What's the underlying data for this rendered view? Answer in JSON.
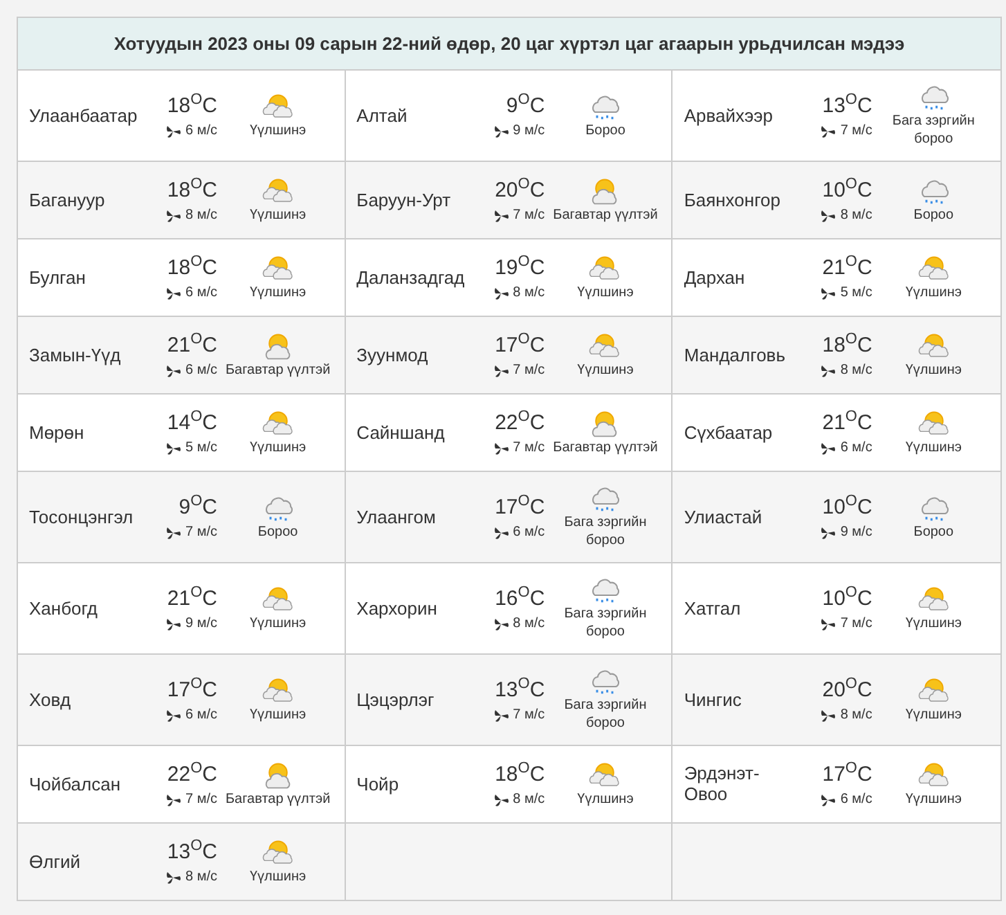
{
  "title": "Хотуудын 2023 оны 09 сарын 22-ний өдөр, 20 цаг хүртэл цаг агаарын урьдчилсан мэдээ",
  "rows": [
    [
      {
        "city": "Улаанбаатар",
        "temp": "18$^{O}$C",
        "wind": "6 м/с",
        "kind": "partly_cloudy",
        "condition": "Үүлшинэ"
      },
      {
        "city": "Алтай",
        "temp": "9$^{O}$C",
        "wind": "9 м/с",
        "kind": "rain",
        "condition": "Бороо"
      },
      {
        "city": "Арвайхээр",
        "temp": "13$^{O}$C",
        "wind": "7 м/с",
        "kind": "rain",
        "condition": "Бага зэргийн бороо"
      }
    ],
    [
      {
        "city": "Багануур",
        "temp": "18$^{O}$C",
        "wind": "8 м/с",
        "kind": "partly_cloudy",
        "condition": "Үүлшинэ"
      },
      {
        "city": "Баруун-Урт",
        "temp": "20$^{O}$C",
        "wind": "7 м/с",
        "kind": "sun_cloud",
        "condition": "Багавтар үүлтэй"
      },
      {
        "city": "Баянхонгор",
        "temp": "10$^{O}$C",
        "wind": "8 м/с",
        "kind": "rain",
        "condition": "Бороо"
      }
    ],
    [
      {
        "city": "Булган",
        "temp": "18$^{O}$C",
        "wind": "6 м/с",
        "kind": "partly_cloudy",
        "condition": "Үүлшинэ"
      },
      {
        "city": "Даланзадгад",
        "temp": "19$^{O}$C",
        "wind": "8 м/с",
        "kind": "partly_cloudy",
        "condition": "Үүлшинэ"
      },
      {
        "city": "Дархан",
        "temp": "21$^{O}$C",
        "wind": "5 м/с",
        "kind": "partly_cloudy",
        "condition": "Үүлшинэ"
      }
    ],
    [
      {
        "city": "Замын-Үүд",
        "temp": "21$^{O}$C",
        "wind": "6 м/с",
        "kind": "sun_cloud",
        "condition": "Багавтар үүлтэй"
      },
      {
        "city": "Зуунмод",
        "temp": "17$^{O}$C",
        "wind": "7 м/с",
        "kind": "partly_cloudy",
        "condition": "Үүлшинэ"
      },
      {
        "city": "Мандалговь",
        "temp": "18$^{O}$C",
        "wind": "8 м/с",
        "kind": "partly_cloudy",
        "condition": "Үүлшинэ"
      }
    ],
    [
      {
        "city": "Мөрөн",
        "temp": "14$^{O}$C",
        "wind": "5 м/с",
        "kind": "partly_cloudy",
        "condition": "Үүлшинэ"
      },
      {
        "city": "Сайншанд",
        "temp": "22$^{O}$C",
        "wind": "7 м/с",
        "kind": "sun_cloud",
        "condition": "Багавтар үүлтэй"
      },
      {
        "city": "Сүхбаатар",
        "temp": "21$^{O}$C",
        "wind": "6 м/с",
        "kind": "partly_cloudy",
        "condition": "Үүлшинэ"
      }
    ],
    [
      {
        "city": "Тосонцэнгэл",
        "temp": "9$^{O}$C",
        "wind": "7 м/с",
        "kind": "rain",
        "condition": "Бороо"
      },
      {
        "city": "Улаангом",
        "temp": "17$^{O}$C",
        "wind": "6 м/с",
        "kind": "rain",
        "condition": "Бага зэргийн бороо"
      },
      {
        "city": "Улиастай",
        "temp": "10$^{O}$C",
        "wind": "9 м/с",
        "kind": "rain",
        "condition": "Бороо"
      }
    ],
    [
      {
        "city": "Ханбогд",
        "temp": "21$^{O}$C",
        "wind": "9 м/с",
        "kind": "partly_cloudy",
        "condition": "Үүлшинэ"
      },
      {
        "city": "Хархорин",
        "temp": "16$^{O}$C",
        "wind": "8 м/с",
        "kind": "rain",
        "condition": "Бага зэргийн бороо"
      },
      {
        "city": "Хатгал",
        "temp": "10$^{O}$C",
        "wind": "7 м/с",
        "kind": "partly_cloudy",
        "condition": "Үүлшинэ"
      }
    ],
    [
      {
        "city": "Ховд",
        "temp": "17$^{O}$C",
        "wind": "6 м/с",
        "kind": "partly_cloudy",
        "condition": "Үүлшинэ"
      },
      {
        "city": "Цэцэрлэг",
        "temp": "13$^{O}$C",
        "wind": "7 м/с",
        "kind": "rain",
        "condition": "Бага зэргийн бороо"
      },
      {
        "city": "Чингис",
        "temp": "20$^{O}$C",
        "wind": "8 м/с",
        "kind": "partly_cloudy",
        "condition": "Үүлшинэ"
      }
    ],
    [
      {
        "city": "Чойбалсан",
        "temp": "22$^{O}$C",
        "wind": "7 м/с",
        "kind": "sun_cloud",
        "condition": "Багавтар үүлтэй"
      },
      {
        "city": "Чойр",
        "temp": "18$^{O}$C",
        "wind": "8 м/с",
        "kind": "partly_cloudy",
        "condition": "Үүлшинэ"
      },
      {
        "city": "Эрдэнэт-Овоо",
        "temp": "17$^{O}$C",
        "wind": "6 м/с",
        "kind": "partly_cloudy",
        "condition": "Үүлшинэ"
      }
    ],
    [
      {
        "city": "Өлгий",
        "temp": "13$^{O}$C",
        "wind": "8 м/с",
        "kind": "partly_cloudy",
        "condition": "Үүлшинэ"
      }
    ]
  ]
}
